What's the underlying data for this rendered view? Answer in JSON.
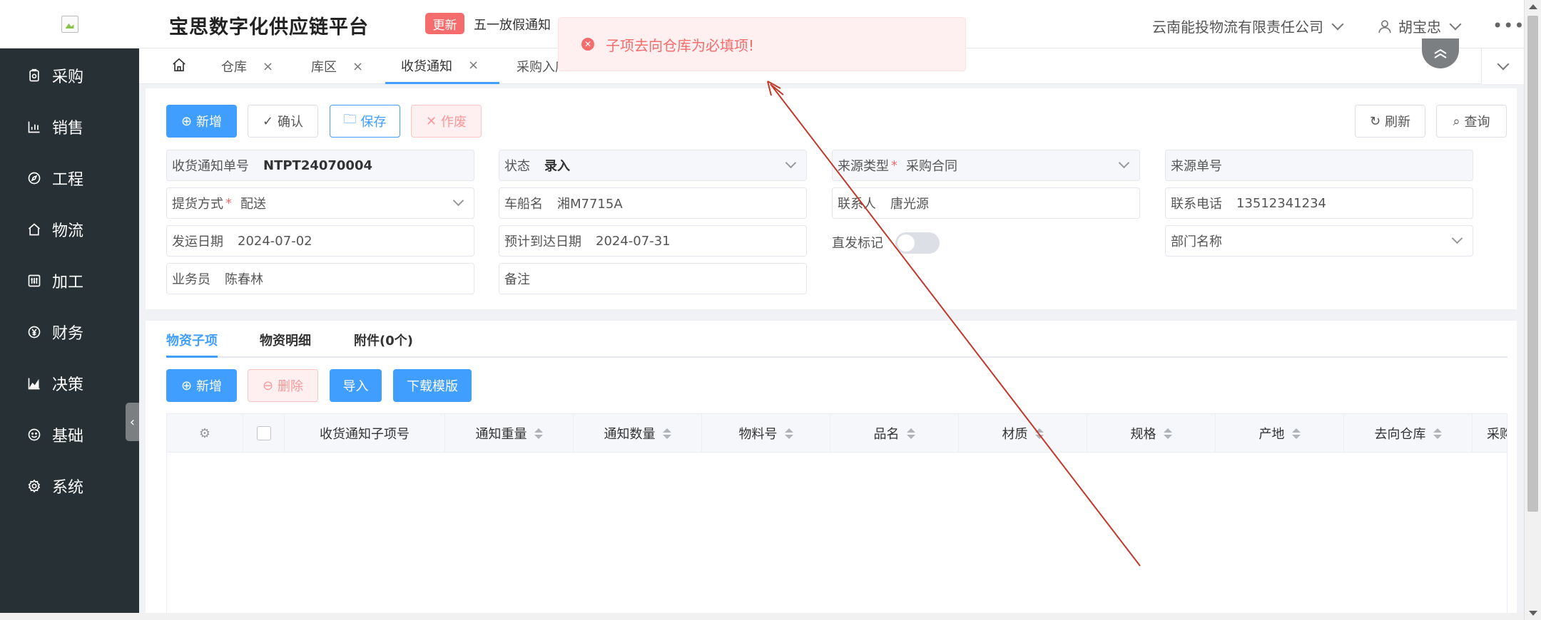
{
  "header": {
    "title": "宝思数字化供应链平台",
    "update_badge": "更新",
    "notice": "五一放假通知",
    "company": "云南能投物流有限责任公司",
    "user": "胡宝忠",
    "more": "•••"
  },
  "sidebar": {
    "items": [
      {
        "label": "采购",
        "icon": "purchase-icon"
      },
      {
        "label": "销售",
        "icon": "bar-chart-icon"
      },
      {
        "label": "工程",
        "icon": "compass-icon"
      },
      {
        "label": "物流",
        "icon": "home-icon"
      },
      {
        "label": "加工",
        "icon": "sliders-icon"
      },
      {
        "label": "财务",
        "icon": "yen-icon"
      },
      {
        "label": "决策",
        "icon": "area-chart-icon"
      },
      {
        "label": "基础",
        "icon": "smile-icon"
      },
      {
        "label": "系统",
        "icon": "gear-icon"
      }
    ]
  },
  "tabs": [
    {
      "label": "仓库"
    },
    {
      "label": "库区"
    },
    {
      "label": "收货通知",
      "active": true
    },
    {
      "label": "采购入库"
    }
  ],
  "toolbar": {
    "add": "新增",
    "confirm": "确认",
    "save": "保存",
    "void": "作废",
    "refresh": "刷新",
    "query": "查询"
  },
  "form": {
    "notice_no_label": "收货通知单号",
    "notice_no": "NTPT24070004",
    "status_label": "状态",
    "status": "录入",
    "source_type_label": "来源类型",
    "source_type": "采购合同",
    "source_no_label": "来源单号",
    "delivery_method_label": "提货方式",
    "delivery_method": "配送",
    "vessel_label": "车船名",
    "vessel": "湘M7715A",
    "contact_label": "联系人",
    "contact": "唐光源",
    "phone_label": "联系电话",
    "phone": "13512341234",
    "ship_date_label": "发运日期",
    "ship_date": "2024-07-02",
    "eta_label": "预计到达日期",
    "eta": "2024-07-31",
    "direct_label": "直发标记",
    "dept_label": "部门名称",
    "salesman_label": "业务员",
    "salesman": "陈春林",
    "remark_label": "备注"
  },
  "subtabs": [
    "物资子项",
    "物资明细",
    "附件(0个)"
  ],
  "table_toolbar": {
    "add": "新增",
    "delete": "删除",
    "import": "导入",
    "download": "下载模版"
  },
  "table": {
    "columns": [
      "收货通知子项号",
      "通知重量",
      "通知数量",
      "物料号",
      "品名",
      "材质",
      "规格",
      "产地",
      "去向仓库",
      "采购计划"
    ]
  },
  "toast": {
    "message": "子项去向仓库为必填项!"
  },
  "colors": {
    "primary": "#409eff",
    "danger": "#f56c6c",
    "sidebar": "#273135"
  }
}
